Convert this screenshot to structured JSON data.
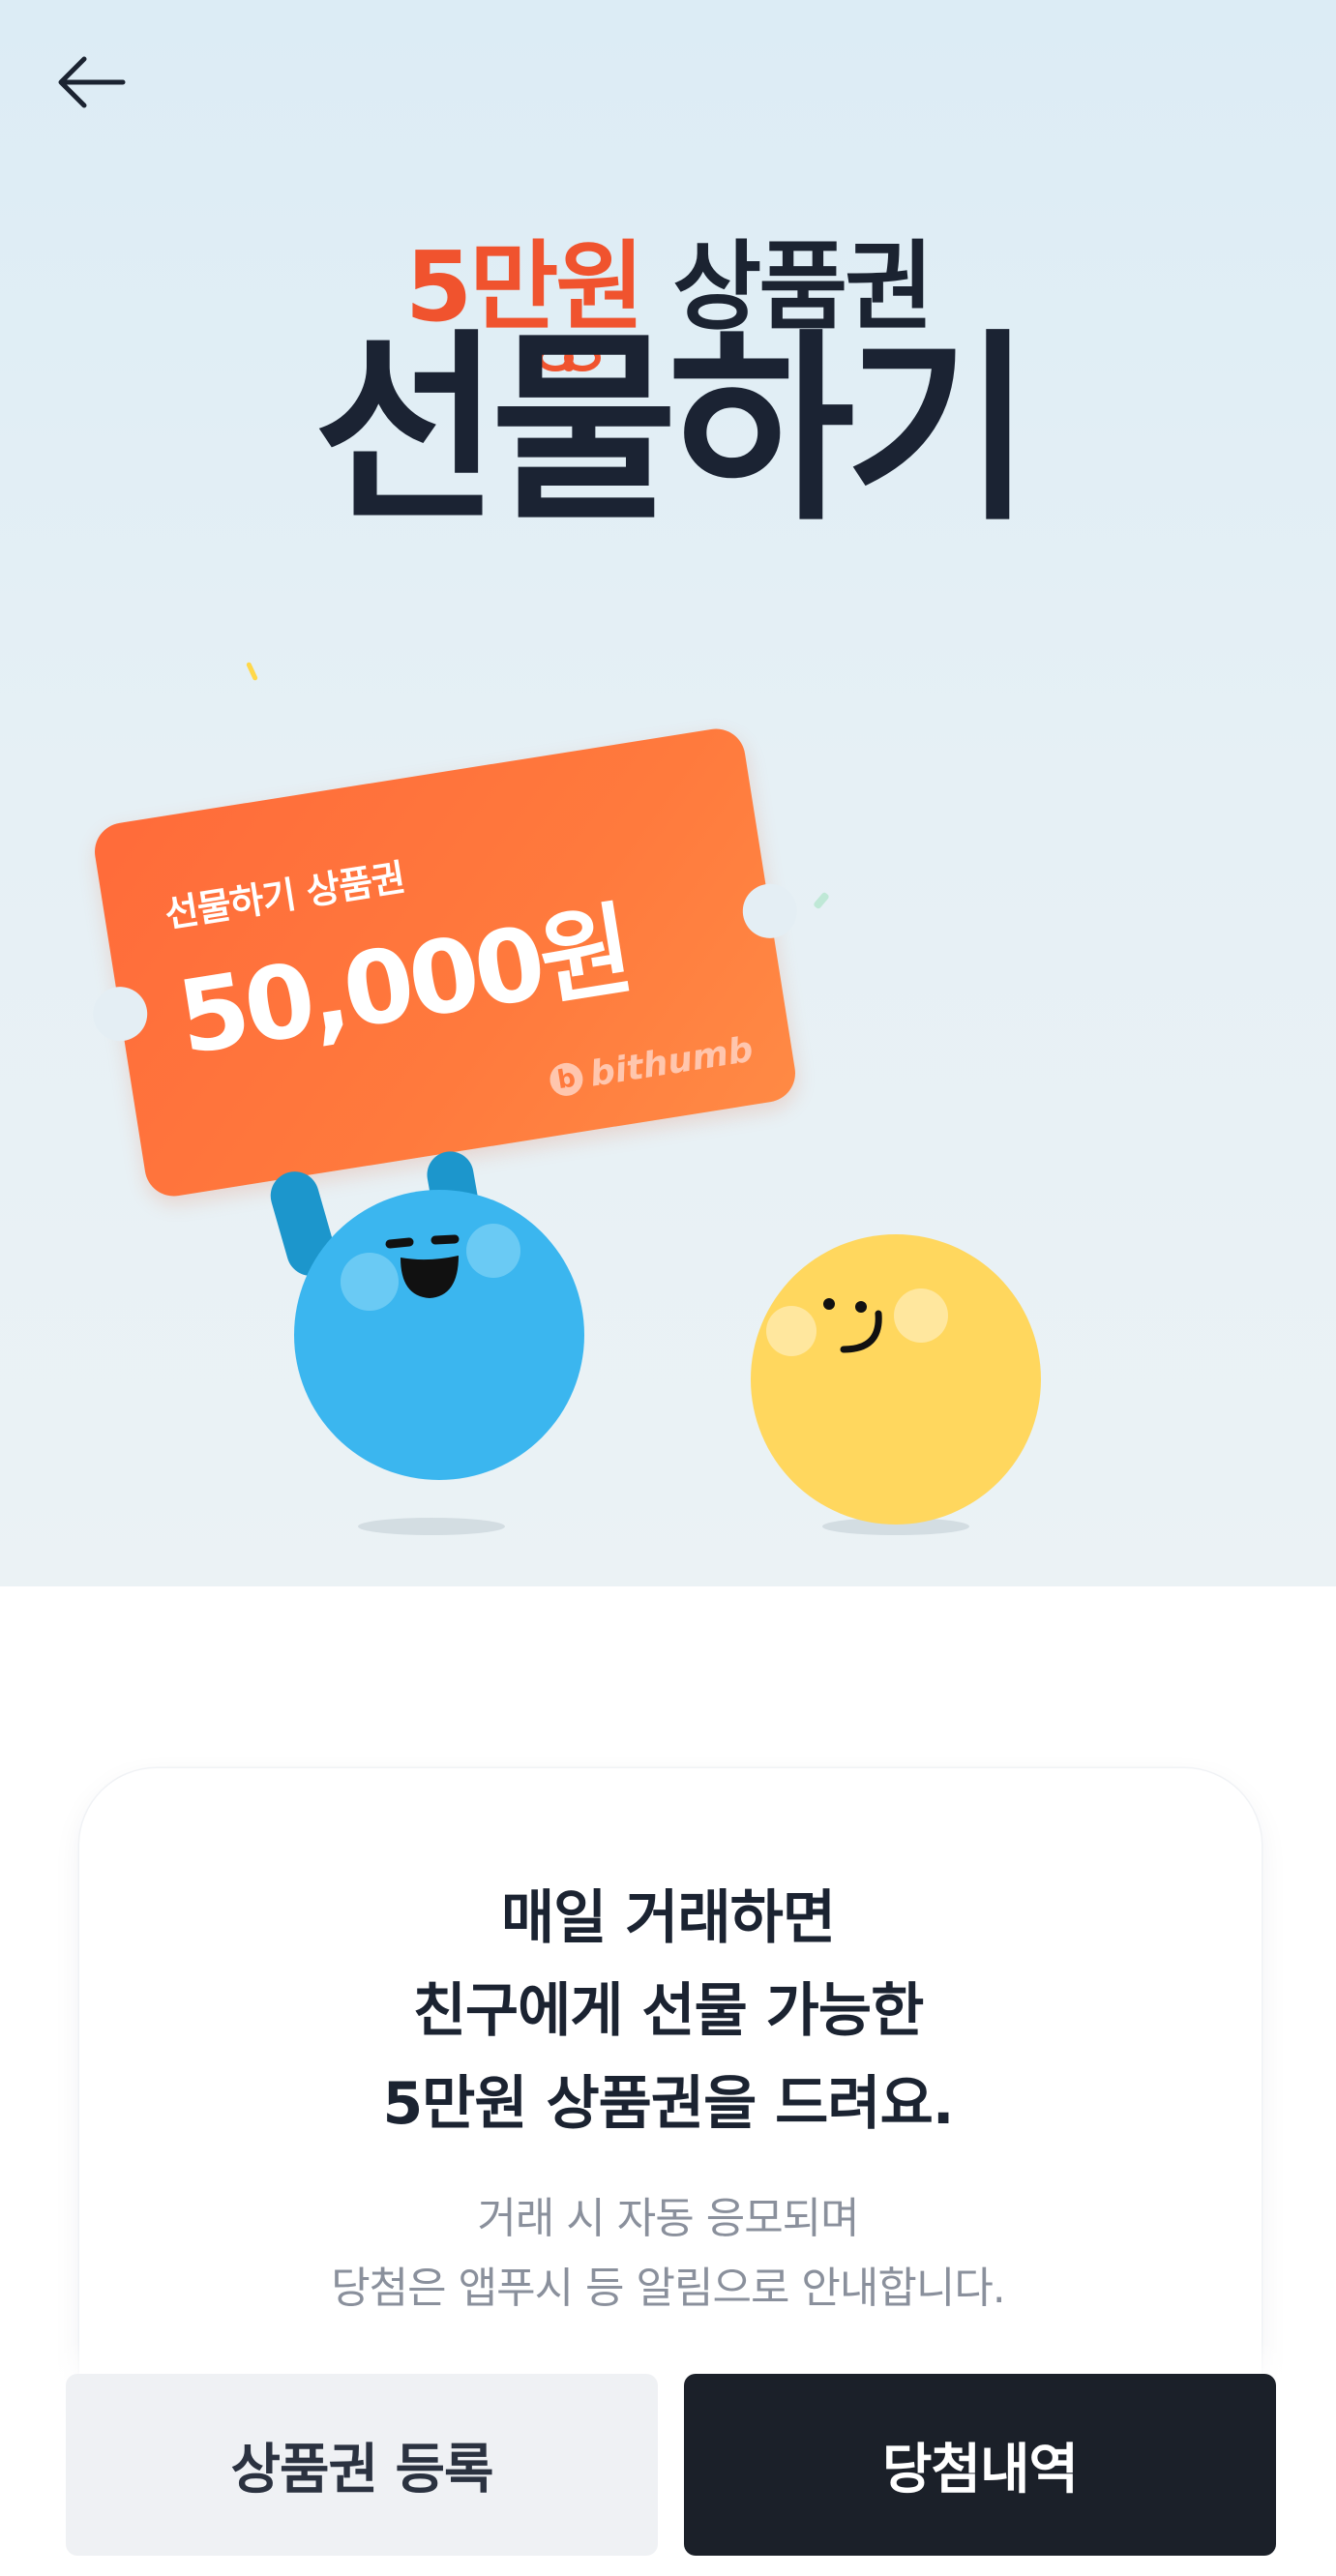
{
  "header": {
    "back_icon": "arrow-left-icon"
  },
  "hero": {
    "headline_amount": "5만원",
    "headline_rest": "상품권",
    "title": "선물하기",
    "ticket": {
      "label": "선물하기 상품권",
      "value": "50,000원",
      "brand": "bithumb"
    },
    "characters": [
      "blue-ball-character",
      "yellow-ball-character"
    ],
    "colors": {
      "accent": "#f0532e",
      "ticket": "#ff7a3d",
      "blue": "#3bb6ef",
      "yellow": "#ffd75e"
    }
  },
  "card": {
    "title_lines": [
      "매일 거래하면",
      "친구에게 선물 가능한",
      "5만원 상품권을 드려요."
    ],
    "sub_lines": [
      "거래 시 자동 응모되며",
      "당첨은 앱푸시 등 알림으로 안내합니다."
    ]
  },
  "buttons": {
    "register": "상품권 등록",
    "history": "당첨내역"
  }
}
